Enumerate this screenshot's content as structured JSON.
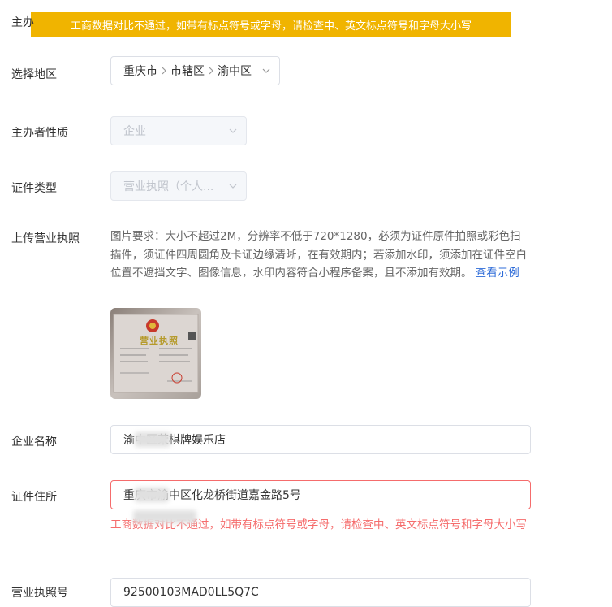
{
  "toast": {
    "message": "工商数据对比不通过，如带有标点符号或字母，请检查中、英文标点符号和字母大小写"
  },
  "form": {
    "top_label_partial": "主办",
    "region": {
      "label": "选择地区",
      "values": [
        "重庆市",
        "市辖区",
        "渝中区"
      ]
    },
    "organizer_type": {
      "label": "主办者性质",
      "value": "企业"
    },
    "cert_type": {
      "label": "证件类型",
      "value": "营业执照（个人..."
    },
    "upload": {
      "label": "上传营业执照",
      "requirement": "图片要求：大小不超过2M，分辨率不低于720*1280，必须为证件原件拍照或彩色扫描件，须证件四周圆角及卡证边缘清晰，在有效期内；若添加水印，须添加在证件空白位置不遮挡文字、图像信息，水印内容符合小程序备案，且不添加有效期。",
      "example_link": "查看示例",
      "thumb_title": "营业执照"
    },
    "company_name": {
      "label": "企业名称",
      "value": "渝中区茉棋牌娱乐店"
    },
    "cert_address": {
      "label": "证件住所",
      "value": "重庆市渝中区化龙桥街道嘉金路5号",
      "error": "工商数据对比不通过，如带有标点符号或字母，请检查中、英文标点符号和字母大小写"
    },
    "license_no": {
      "label": "营业执照号",
      "value": "92500103MAD0LL5Q7C"
    }
  },
  "colors": {
    "toast_bg": "#f0b400",
    "error": "#f56c6c",
    "link": "#2d6bd8"
  }
}
